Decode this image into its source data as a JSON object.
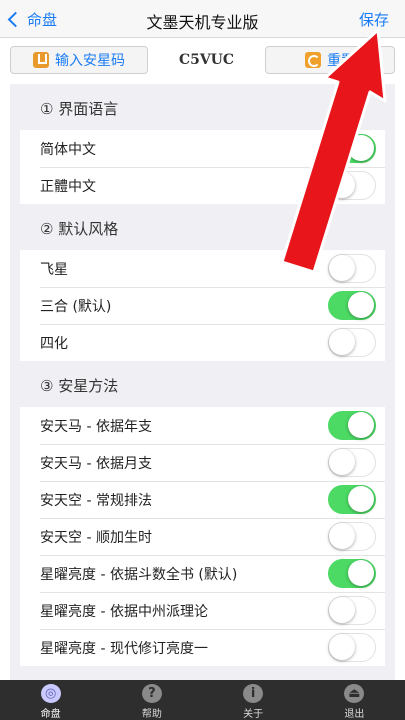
{
  "nav": {
    "back_label": "命盘",
    "title": "文墨天机专业版",
    "save_label": "保存"
  },
  "toolbar": {
    "enter_code_label": "输入安星码",
    "code": "C5VUC",
    "reset_label": "重置"
  },
  "sections": [
    {
      "header": "① 界面语言",
      "rows": [
        {
          "label": "简体中文",
          "on": true
        },
        {
          "label": "正體中文",
          "on": false
        }
      ]
    },
    {
      "header": "② 默认风格",
      "rows": [
        {
          "label": "飞星",
          "on": false
        },
        {
          "label": "三合 (默认)",
          "on": true
        },
        {
          "label": "四化",
          "on": false
        }
      ]
    },
    {
      "header": "③ 安星方法",
      "rows": [
        {
          "label": "安天马 - 依据年支",
          "on": true
        },
        {
          "label": "安天马 - 依据月支",
          "on": false
        },
        {
          "label": "安天空 - 常规排法",
          "on": true
        },
        {
          "label": "安天空 - 顺加生时",
          "on": false
        },
        {
          "label": "星曜亮度 - 依据斗数全书 (默认)",
          "on": true
        },
        {
          "label": "星曜亮度 - 依据中州派理论",
          "on": false
        },
        {
          "label": "星曜亮度 - 现代修订亮度一",
          "on": false
        }
      ]
    }
  ],
  "tabbar": {
    "items": [
      {
        "label": "命盘",
        "icon": "chart-disc-icon",
        "glyph": "◎"
      },
      {
        "label": "帮助",
        "icon": "help-icon",
        "glyph": "?"
      },
      {
        "label": "关于",
        "icon": "info-icon",
        "glyph": "i"
      },
      {
        "label": "退出",
        "icon": "exit-icon",
        "glyph": "⏏"
      }
    ]
  },
  "colors": {
    "accent": "#1a7cf5",
    "toggle_on": "#4cd964",
    "annotation_arrow": "#e8161b"
  }
}
